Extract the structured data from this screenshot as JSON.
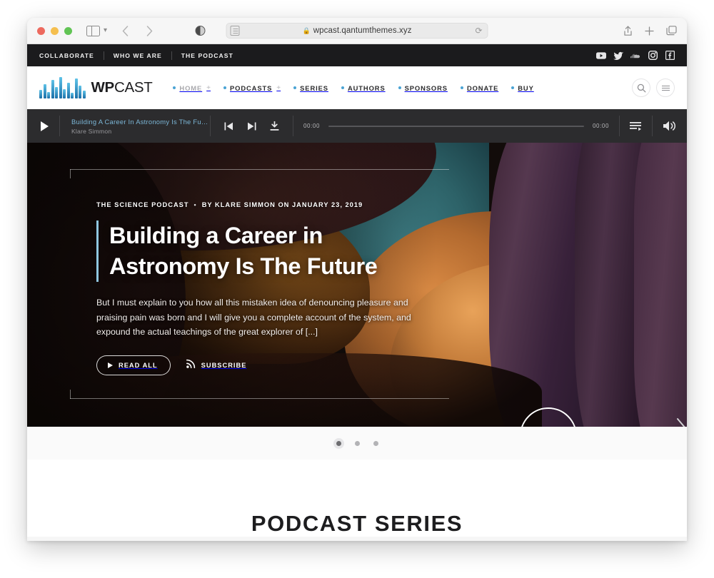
{
  "browser": {
    "url": "wpcast.qantumthemes.xyz",
    "lock_icon": "lock-icon",
    "reload_icon": "reload-icon",
    "back_icon": "chevron-left-icon",
    "forward_icon": "chevron-right-icon",
    "sidebar_icon": "sidebar-icon",
    "shield_icon": "privacy-shield-icon",
    "reader_icon": "reader-mode-icon",
    "share_icon": "share-icon",
    "newtab_icon": "plus-icon",
    "tabs_icon": "tab-overview-icon"
  },
  "topbar": {
    "links": [
      "COLLABORATE",
      "WHO WE ARE",
      "THE PODCAST"
    ],
    "socials": [
      "youtube-icon",
      "twitter-icon",
      "soundcloud-icon",
      "instagram-icon",
      "facebook-icon"
    ]
  },
  "header": {
    "logo": {
      "bold": "WP",
      "light": "CAST"
    },
    "nav": [
      {
        "label": "HOME",
        "plus": "+",
        "muted": true
      },
      {
        "label": "PODCASTS",
        "plus": "+",
        "muted": false
      },
      {
        "label": "SERIES",
        "plus": "",
        "muted": false
      },
      {
        "label": "AUTHORS",
        "plus": "",
        "muted": false
      },
      {
        "label": "SPONSORS",
        "plus": "",
        "muted": false
      },
      {
        "label": "DONATE",
        "plus": "",
        "muted": false
      },
      {
        "label": "BUY",
        "plus": "",
        "muted": false
      }
    ],
    "search_icon": "search-icon",
    "menu_icon": "hamburger-menu-icon",
    "accent_color": "#4aa3d4"
  },
  "player": {
    "track_title": "Building A Career In Astronomy Is The Fu…",
    "track_author": "Klare Simmon",
    "elapsed": "00:00",
    "duration": "00:00",
    "play_icon": "play-icon",
    "prev_icon": "skip-previous-icon",
    "next_icon": "skip-next-icon",
    "download_icon": "download-icon",
    "playlist_icon": "playlist-icon",
    "volume_icon": "volume-icon",
    "title_color": "#7bb6d6"
  },
  "hero": {
    "category": "THE SCIENCE PODCAST",
    "separator": "•",
    "byline": "BY KLARE SIMMON ON JANUARY 23, 2019",
    "title": "Building a Career in Astronomy Is The Future",
    "excerpt": "But I must explain to you how all this mistaken idea of denouncing pleasure and praising pain was born and I will give you a complete account of the system, and expound the actual teachings of the great explorer of [...]",
    "read_all_label": "READ ALL",
    "subscribe_label": "SUBSCRIBE",
    "read_all_icon": "play-icon",
    "subscribe_icon": "rss-icon",
    "play_overlay_icon": "play-circle-icon",
    "next_slide_icon": "chevron-right-icon",
    "accent_border_color": "#8fc6e0"
  },
  "carousel": {
    "slides": 3,
    "active": 1
  },
  "section": {
    "title": "PODCAST SERIES"
  }
}
